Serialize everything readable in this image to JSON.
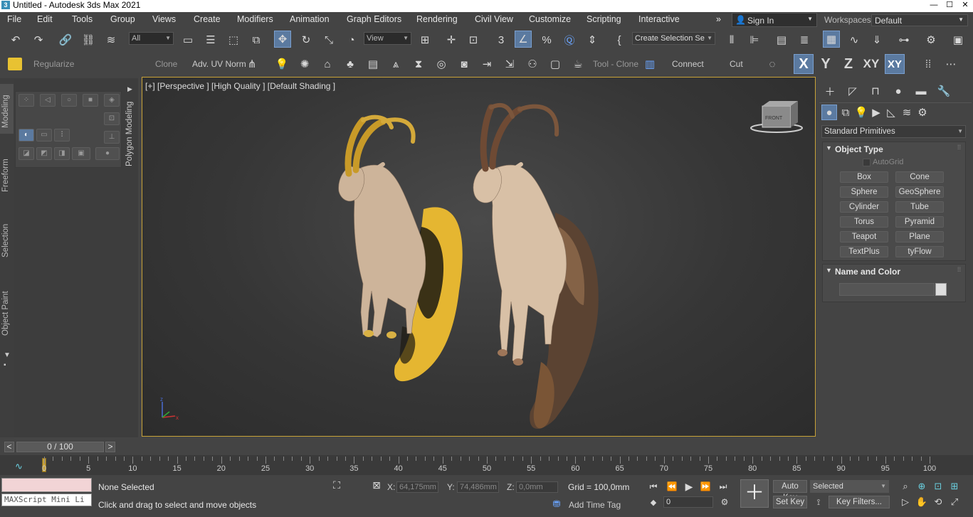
{
  "app": {
    "title": "Untitled - Autodesk 3ds Max 2021"
  },
  "menu": [
    "File",
    "Edit",
    "Tools",
    "Group",
    "Views",
    "Create",
    "Modifiers",
    "Animation",
    "Graph Editors",
    "Rendering",
    "Civil View",
    "Customize",
    "Scripting",
    "Interactive"
  ],
  "signin": {
    "label": "Sign In"
  },
  "workspaces": {
    "label": "Workspaces:",
    "value": "Default"
  },
  "toolbar1": {
    "filter": "All",
    "refcoord": "View",
    "selection_set": "Create Selection Se"
  },
  "toolbar2": {
    "regularize": "Regularize",
    "clone": "Clone",
    "adv_uv": "Adv. UV Norm",
    "tool_clone": "Tool - Clone",
    "connect": "Connect",
    "cut": "Cut",
    "x": "X",
    "y": "Y",
    "z": "Z",
    "xy": "XY",
    "xy2": "XY"
  },
  "ribbon_tabs": [
    "Modeling",
    "Freeform",
    "Selection",
    "Object Paint"
  ],
  "ribbon": {
    "polygon_modeling": "Polygon Modeling"
  },
  "viewport": {
    "label": "[+] [Perspective ] [High Quality ] [Default Shading ]",
    "viewcube": "FRONT",
    "axis": {
      "z": "z",
      "x": "x",
      "y": "y"
    }
  },
  "command_panel": {
    "dropdown": "Standard Primitives",
    "object_type": {
      "title": "Object Type",
      "autogrid": "AutoGrid",
      "buttons": [
        "Box",
        "Cone",
        "Sphere",
        "GeoSphere",
        "Cylinder",
        "Tube",
        "Torus",
        "Pyramid",
        "Teapot",
        "Plane",
        "TextPlus",
        "tyFlow"
      ]
    },
    "name_color": {
      "title": "Name and Color"
    }
  },
  "timeslider": {
    "frame": "0 / 100",
    "prev": "<",
    "next": ">"
  },
  "trackbar": {
    "ticks": [
      "0",
      "5",
      "10",
      "15",
      "20",
      "25",
      "30",
      "35",
      "40",
      "45",
      "50",
      "55",
      "60",
      "65",
      "70",
      "75",
      "80",
      "85",
      "90",
      "95",
      "100"
    ]
  },
  "status": {
    "maxscript": "MAXScript Mini Li",
    "selection": "None Selected",
    "prompt": "Click and drag to select and move objects",
    "x_label": "X:",
    "x_value": "64,175mm",
    "y_label": "Y:",
    "y_value": "74,486mm",
    "z_label": "Z:",
    "z_value": "0,0mm",
    "grid": "Grid = 100,0mm",
    "add_time_tag": "Add Time Tag",
    "frame_value": "0",
    "auto_key": "Auto Key",
    "set_key": "Set Key",
    "selected_dd": "Selected",
    "key_filters": "Key Filters..."
  }
}
